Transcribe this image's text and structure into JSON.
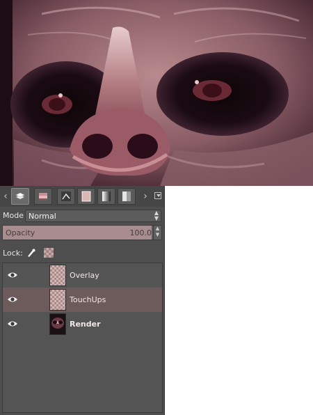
{
  "canvas": {
    "description_icon": "skull-face-artwork"
  },
  "tabs": [
    {
      "icon": "layers-tab-icon",
      "active": true
    },
    {
      "icon": "channels-tab-icon",
      "active": false
    },
    {
      "icon": "paths-tab-icon",
      "active": false
    },
    {
      "icon": "color-swatch-tab-icon",
      "active": false
    },
    {
      "icon": "gradient-tab-icon",
      "active": false
    },
    {
      "icon": "pattern-tab-icon",
      "active": false
    }
  ],
  "mode": {
    "label": "Mode",
    "value": "Normal"
  },
  "opacity": {
    "label": "Opacity",
    "value": "100.0",
    "percent": 100
  },
  "lock": {
    "label": "Lock:"
  },
  "layers": [
    {
      "name": "Overlay",
      "visible": true,
      "selected": false,
      "bold": false
    },
    {
      "name": "TouchUps",
      "visible": true,
      "selected": true,
      "bold": false
    },
    {
      "name": "Render",
      "visible": true,
      "selected": false,
      "bold": true
    }
  ],
  "colors": {
    "accent": "#a78d8f",
    "selected_row": "#6d5a5b",
    "panel": "#4e4e4e"
  }
}
